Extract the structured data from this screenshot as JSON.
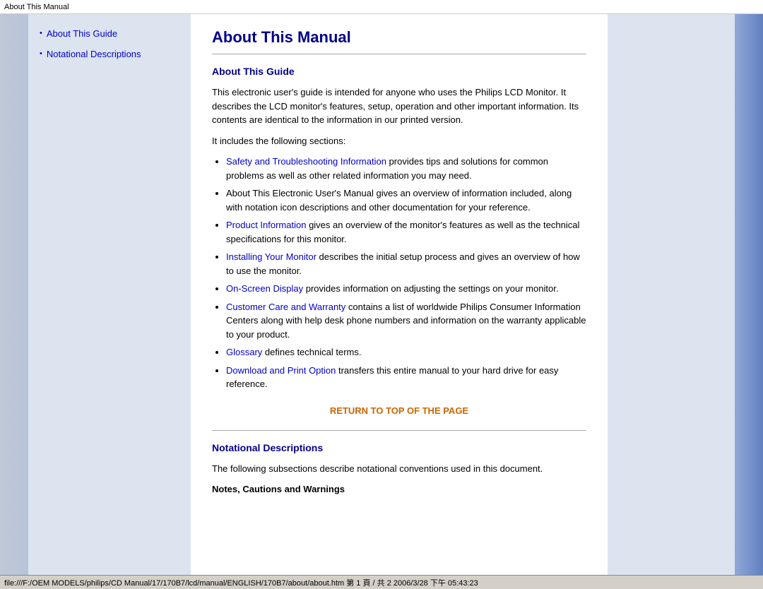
{
  "titleBar": {
    "text": "About This Manual"
  },
  "sidebar": {
    "items": [
      {
        "label": "About This Guide",
        "href": "#about-this-guide"
      },
      {
        "label": "Notational Descriptions",
        "href": "#notational-descriptions"
      }
    ]
  },
  "main": {
    "pageTitle": "About This Manual",
    "sections": [
      {
        "id": "about-this-guide",
        "title": "About This Guide",
        "paragraphs": [
          "This electronic user's guide is intended for anyone who uses the Philips LCD Monitor. It describes the LCD monitor's features, setup, operation and other important information. Its contents are identical to the information in our printed version.",
          "It includes the following sections:"
        ],
        "listItems": [
          {
            "linkText": "Safety and Troubleshooting Information",
            "linkHref": "#",
            "rest": " provides tips and solutions for common problems as well as other related information you may need."
          },
          {
            "linkText": null,
            "rest": "About This Electronic User's Manual gives an overview of information included, along with notation icon descriptions and other documentation for your reference."
          },
          {
            "linkText": "Product Information",
            "linkHref": "#",
            "rest": " gives an overview of the monitor's features as well as the technical specifications for this monitor."
          },
          {
            "linkText": "Installing Your Monitor",
            "linkHref": "#",
            "rest": " describes the initial setup process and gives an overview of how to use the monitor."
          },
          {
            "linkText": "On-Screen Display",
            "linkHref": "#",
            "rest": " provides information on adjusting the settings on your monitor."
          },
          {
            "linkText": "Customer Care and Warranty",
            "linkHref": "#",
            "rest": " contains a list of worldwide Philips Consumer Information Centers along with help desk phone numbers and information on the warranty applicable to your product."
          },
          {
            "linkText": "Glossary",
            "linkHref": "#",
            "rest": " defines technical terms."
          },
          {
            "linkText": "Download and Print Option",
            "linkHref": "#",
            "rest": " transfers this entire manual to your hard drive for easy reference."
          }
        ]
      }
    ],
    "returnToTop": "RETURN TO TOP OF THE PAGE",
    "section2": {
      "id": "notational-descriptions",
      "title": "Notational Descriptions",
      "paragraph": "The following subsections describe notational conventions used in this document.",
      "subTitle": "Notes, Cautions and Warnings"
    }
  },
  "statusBar": {
    "text": "file:///F:/OEM MODELS/philips/CD Manual/17/170B7/lcd/manual/ENGLISH/170B7/about/about.htm 第 1 頁 / 共 2 2006/3/28 下午 05:43:23"
  }
}
